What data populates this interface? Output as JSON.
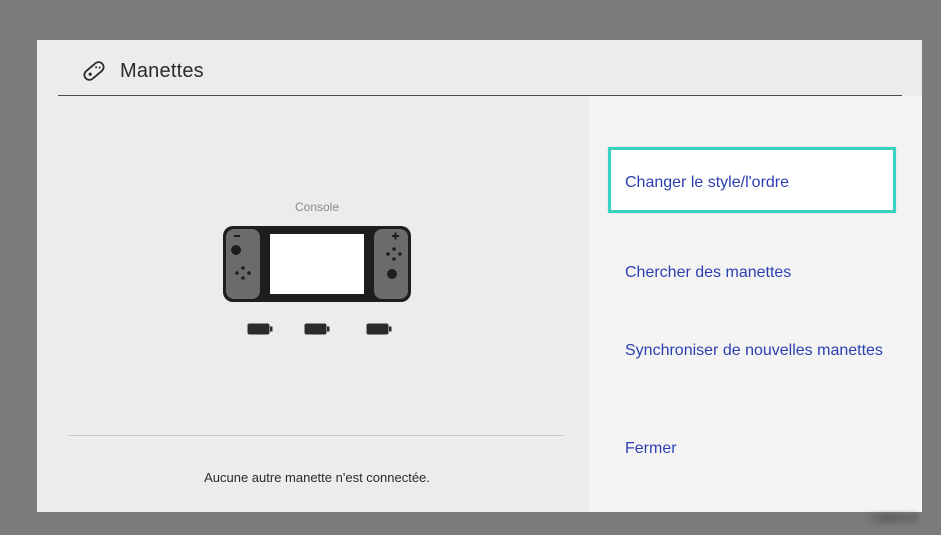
{
  "header": {
    "title": "Manettes",
    "icon": "controller-icon"
  },
  "console": {
    "label": "Console",
    "icon": "switch-console-icon",
    "batteries": [
      "battery-icon",
      "battery-icon",
      "battery-icon"
    ]
  },
  "status": {
    "message": "Aucune autre manette n'est connectée."
  },
  "menu": {
    "items": [
      {
        "label": "Changer le style/l'ordre",
        "selected": true
      },
      {
        "label": "Chercher des manettes",
        "selected": false
      },
      {
        "label": "Synchroniser de nouvelles manettes",
        "selected": false
      },
      {
        "label": "Fermer",
        "selected": false
      }
    ]
  },
  "colors": {
    "background": "#7a7b7d",
    "dialog": "#ececec",
    "menu_text": "#2c3fb0",
    "selection_border": "#35d3c0"
  }
}
